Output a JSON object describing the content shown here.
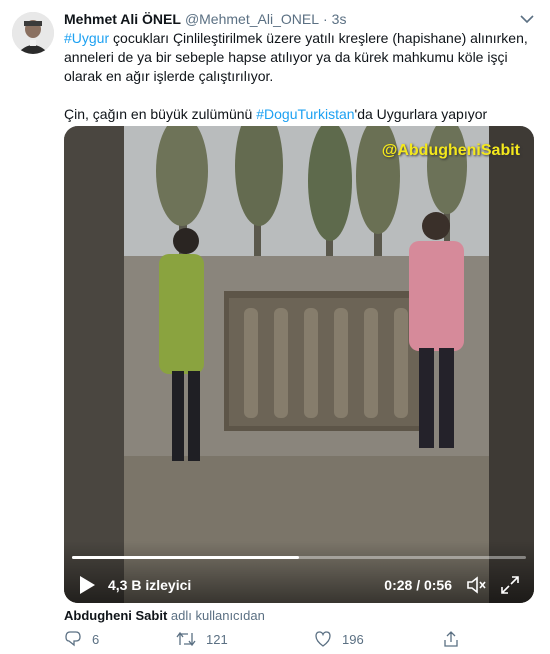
{
  "tweet": {
    "display_name": "Mehmet Ali ÖNEL",
    "handle": "@Mehmet_Ali_ONEL",
    "separator": "·",
    "time": "3s",
    "text": {
      "line1_hashtag": "#Uygur",
      "line1_rest": " çocukları Çinlileştirilmek üzere yatılı kreşlere (hapishane) alınırken,",
      "line2": "anneleri de ya bir sebeple hapse atılıyor ya da  kürek mahkumu köle işçi",
      "line3": "olarak en ağır işlerde çalıştırılıyor.",
      "line4_prefix": "Çin, çağın en büyük zulümünü ",
      "line4_hashtag": "#DoguTurkistan",
      "line4_suffix": "'da Uygurlara yapıyor"
    },
    "media": {
      "watermark": "@AbdugheniSabit",
      "views": "4,3 B izleyici",
      "time_display": "0:28 / 0:56",
      "progress": 0.5
    },
    "attribution": {
      "uploader": "Abdugheni Sabit",
      "suffix": "adlı kullanıcıdan"
    },
    "actions": {
      "reply_count": "6",
      "retweet_count": "121",
      "like_count": "196"
    }
  },
  "colors": {
    "link": "#1da1f2",
    "secondary": "#5b7083",
    "primary_text": "#0f1419",
    "watermark": "#f4e81c"
  },
  "icons": [
    "avatar",
    "caret-down-icon",
    "play-icon",
    "volume-icon",
    "fullscreen-icon",
    "reply-icon",
    "retweet-icon",
    "like-icon",
    "share-icon"
  ]
}
